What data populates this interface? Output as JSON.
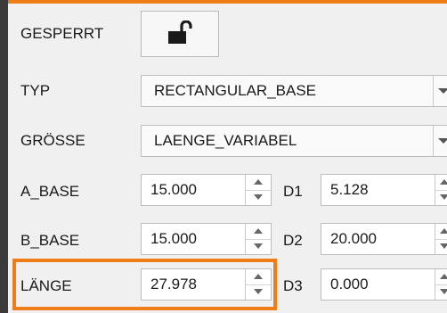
{
  "colors": {
    "highlight": "#ef7d17",
    "panel": "#f0f0f0"
  },
  "rows": {
    "locked": {
      "label": "GESPERRT",
      "icon": "unlocked-padlock-icon"
    },
    "type": {
      "label": "TYP",
      "value": "RECTANGULAR_BASE"
    },
    "size": {
      "label": "GRÖSSE",
      "value": "LAENGE_VARIABEL"
    },
    "a_base": {
      "label": "A_BASE",
      "value": "15.000",
      "d_label": "D1",
      "d_value": "5.128"
    },
    "b_base": {
      "label": "B_BASE",
      "value": "15.000",
      "d_label": "D2",
      "d_value": "20.000"
    },
    "length": {
      "label": "LÄNGE",
      "value": "27.978",
      "d_label": "D3",
      "d_value": "0.000",
      "highlighted": true
    }
  }
}
